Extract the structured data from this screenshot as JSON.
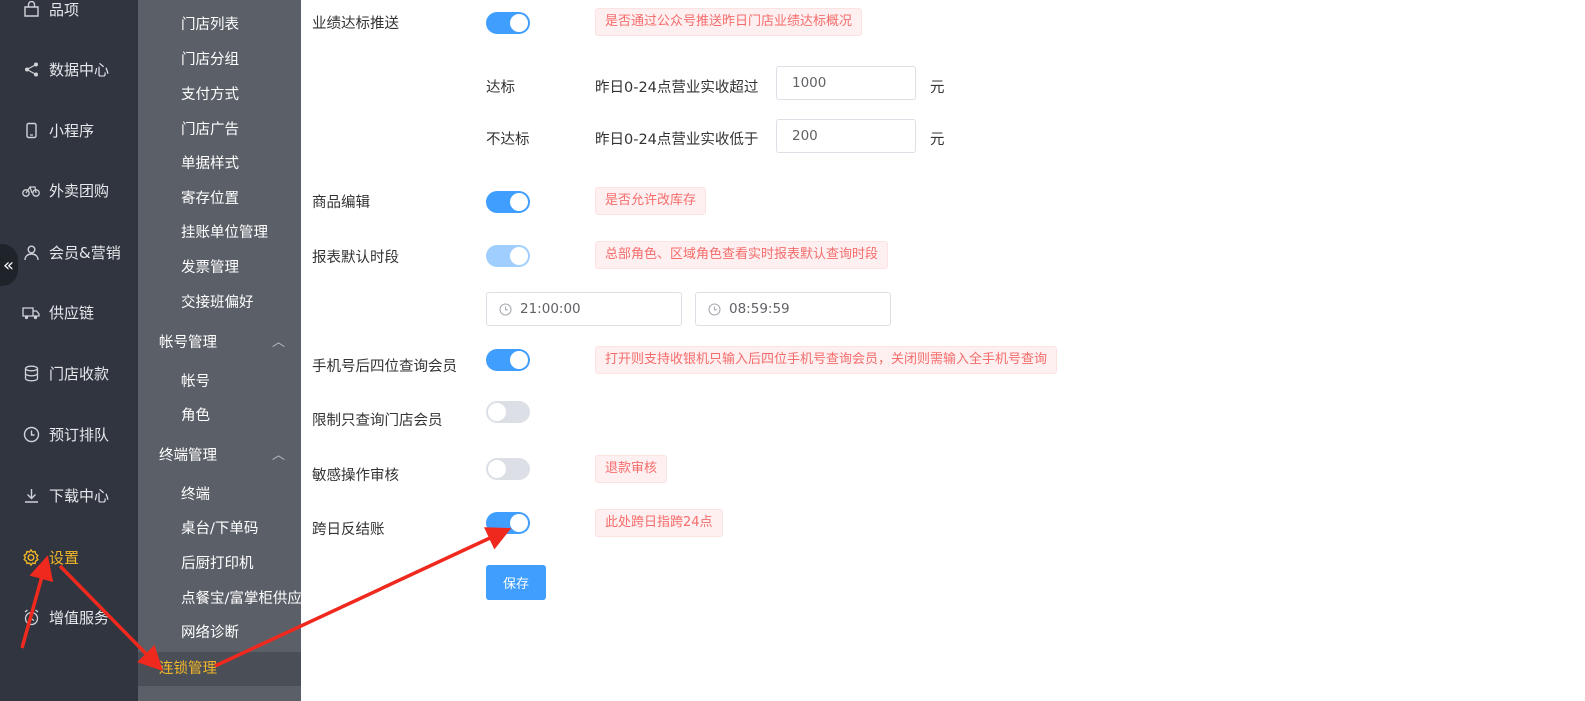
{
  "nav_primary": {
    "items": [
      {
        "label": "品项",
        "icon": "bag-icon"
      },
      {
        "label": "数据中心",
        "icon": "share-icon"
      },
      {
        "label": "小程序",
        "icon": "phone-icon"
      },
      {
        "label": "外卖团购",
        "icon": "bike-icon"
      },
      {
        "label": "会员&营销",
        "icon": "user-icon"
      },
      {
        "label": "供应链",
        "icon": "truck-icon"
      },
      {
        "label": "门店收款",
        "icon": "database-icon"
      },
      {
        "label": "预订排队",
        "icon": "clock-icon"
      },
      {
        "label": "下载中心",
        "icon": "download-icon"
      },
      {
        "label": "设置",
        "icon": "gear-icon",
        "active": true
      },
      {
        "label": "增值服务",
        "icon": "alarm-icon"
      }
    ],
    "collapse_glyph": "«"
  },
  "nav_secondary": {
    "store_items": [
      "门店列表",
      "门店分组",
      "支付方式",
      "门店广告",
      "单据样式",
      "寄存位置",
      "挂账单位管理",
      "发票管理",
      "交接班偏好"
    ],
    "account_group": {
      "label": "帐号管理",
      "items": [
        "帐号",
        "角色"
      ]
    },
    "terminal_group": {
      "label": "终端管理",
      "items": [
        "终端",
        "桌台/下单码",
        "后厨打印机",
        "点餐宝/富掌柜供应",
        "网络诊断"
      ]
    },
    "active_item": "连锁管理"
  },
  "settings": {
    "performance_push": {
      "label": "业绩达标推送",
      "on": true,
      "hint": "是否通过公众号推送昨日门店业绩达标概况"
    },
    "target_met": {
      "label": "达标",
      "desc": "昨日0-24点营业实收超过",
      "value": "1000",
      "unit": "元"
    },
    "target_missed": {
      "label": "不达标",
      "desc": "昨日0-24点营业实收低于",
      "value": "200",
      "unit": "元"
    },
    "product_edit": {
      "label": "商品编辑",
      "on": true,
      "hint": "是否允许改库存"
    },
    "report_period": {
      "label": "报表默认时段",
      "on": true,
      "disabled": true,
      "hint": "总部角色、区域角色查看实时报表默认查询时段",
      "start_time": "21:00:00",
      "end_time": "08:59:59"
    },
    "phone_last4": {
      "label": "手机号后四位查询会员",
      "on": true,
      "hint": "打开则支持收银机只输入后四位手机号查询会员，关闭则需输入全手机号查询"
    },
    "store_member_only": {
      "label": "限制只查询门店会员",
      "on": false
    },
    "sensitive_review": {
      "label": "敏感操作审核",
      "on": false,
      "hint": "退款审核"
    },
    "cross_day": {
      "label": "跨日反结账",
      "on": true,
      "hint": "此处跨日指跨24点"
    },
    "save_label": "保存"
  },
  "colors": {
    "primary": "#409eff",
    "accent": "#f2b629",
    "annotation_red": "#f0291e"
  }
}
